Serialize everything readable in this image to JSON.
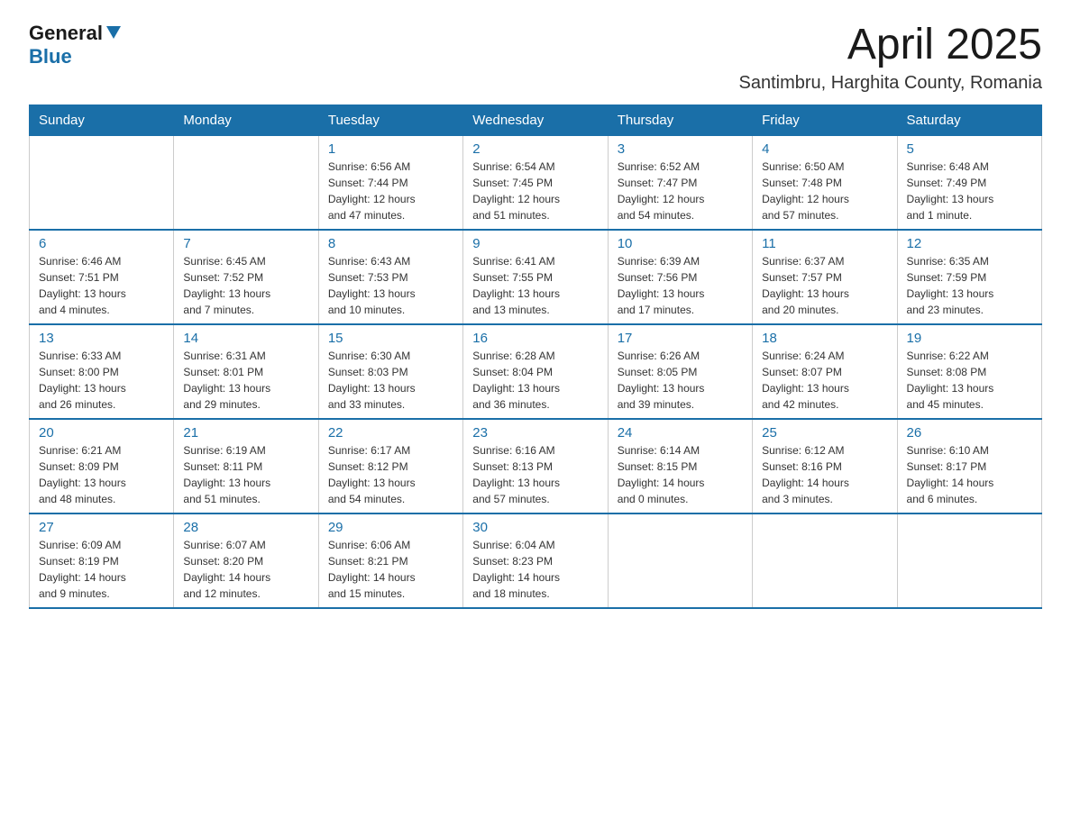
{
  "header": {
    "logo_general": "General",
    "logo_blue": "Blue",
    "month_title": "April 2025",
    "location": "Santimbru, Harghita County, Romania"
  },
  "weekdays": [
    "Sunday",
    "Monday",
    "Tuesday",
    "Wednesday",
    "Thursday",
    "Friday",
    "Saturday"
  ],
  "weeks": [
    [
      {
        "day": "",
        "info": ""
      },
      {
        "day": "",
        "info": ""
      },
      {
        "day": "1",
        "info": "Sunrise: 6:56 AM\nSunset: 7:44 PM\nDaylight: 12 hours\nand 47 minutes."
      },
      {
        "day": "2",
        "info": "Sunrise: 6:54 AM\nSunset: 7:45 PM\nDaylight: 12 hours\nand 51 minutes."
      },
      {
        "day": "3",
        "info": "Sunrise: 6:52 AM\nSunset: 7:47 PM\nDaylight: 12 hours\nand 54 minutes."
      },
      {
        "day": "4",
        "info": "Sunrise: 6:50 AM\nSunset: 7:48 PM\nDaylight: 12 hours\nand 57 minutes."
      },
      {
        "day": "5",
        "info": "Sunrise: 6:48 AM\nSunset: 7:49 PM\nDaylight: 13 hours\nand 1 minute."
      }
    ],
    [
      {
        "day": "6",
        "info": "Sunrise: 6:46 AM\nSunset: 7:51 PM\nDaylight: 13 hours\nand 4 minutes."
      },
      {
        "day": "7",
        "info": "Sunrise: 6:45 AM\nSunset: 7:52 PM\nDaylight: 13 hours\nand 7 minutes."
      },
      {
        "day": "8",
        "info": "Sunrise: 6:43 AM\nSunset: 7:53 PM\nDaylight: 13 hours\nand 10 minutes."
      },
      {
        "day": "9",
        "info": "Sunrise: 6:41 AM\nSunset: 7:55 PM\nDaylight: 13 hours\nand 13 minutes."
      },
      {
        "day": "10",
        "info": "Sunrise: 6:39 AM\nSunset: 7:56 PM\nDaylight: 13 hours\nand 17 minutes."
      },
      {
        "day": "11",
        "info": "Sunrise: 6:37 AM\nSunset: 7:57 PM\nDaylight: 13 hours\nand 20 minutes."
      },
      {
        "day": "12",
        "info": "Sunrise: 6:35 AM\nSunset: 7:59 PM\nDaylight: 13 hours\nand 23 minutes."
      }
    ],
    [
      {
        "day": "13",
        "info": "Sunrise: 6:33 AM\nSunset: 8:00 PM\nDaylight: 13 hours\nand 26 minutes."
      },
      {
        "day": "14",
        "info": "Sunrise: 6:31 AM\nSunset: 8:01 PM\nDaylight: 13 hours\nand 29 minutes."
      },
      {
        "day": "15",
        "info": "Sunrise: 6:30 AM\nSunset: 8:03 PM\nDaylight: 13 hours\nand 33 minutes."
      },
      {
        "day": "16",
        "info": "Sunrise: 6:28 AM\nSunset: 8:04 PM\nDaylight: 13 hours\nand 36 minutes."
      },
      {
        "day": "17",
        "info": "Sunrise: 6:26 AM\nSunset: 8:05 PM\nDaylight: 13 hours\nand 39 minutes."
      },
      {
        "day": "18",
        "info": "Sunrise: 6:24 AM\nSunset: 8:07 PM\nDaylight: 13 hours\nand 42 minutes."
      },
      {
        "day": "19",
        "info": "Sunrise: 6:22 AM\nSunset: 8:08 PM\nDaylight: 13 hours\nand 45 minutes."
      }
    ],
    [
      {
        "day": "20",
        "info": "Sunrise: 6:21 AM\nSunset: 8:09 PM\nDaylight: 13 hours\nand 48 minutes."
      },
      {
        "day": "21",
        "info": "Sunrise: 6:19 AM\nSunset: 8:11 PM\nDaylight: 13 hours\nand 51 minutes."
      },
      {
        "day": "22",
        "info": "Sunrise: 6:17 AM\nSunset: 8:12 PM\nDaylight: 13 hours\nand 54 minutes."
      },
      {
        "day": "23",
        "info": "Sunrise: 6:16 AM\nSunset: 8:13 PM\nDaylight: 13 hours\nand 57 minutes."
      },
      {
        "day": "24",
        "info": "Sunrise: 6:14 AM\nSunset: 8:15 PM\nDaylight: 14 hours\nand 0 minutes."
      },
      {
        "day": "25",
        "info": "Sunrise: 6:12 AM\nSunset: 8:16 PM\nDaylight: 14 hours\nand 3 minutes."
      },
      {
        "day": "26",
        "info": "Sunrise: 6:10 AM\nSunset: 8:17 PM\nDaylight: 14 hours\nand 6 minutes."
      }
    ],
    [
      {
        "day": "27",
        "info": "Sunrise: 6:09 AM\nSunset: 8:19 PM\nDaylight: 14 hours\nand 9 minutes."
      },
      {
        "day": "28",
        "info": "Sunrise: 6:07 AM\nSunset: 8:20 PM\nDaylight: 14 hours\nand 12 minutes."
      },
      {
        "day": "29",
        "info": "Sunrise: 6:06 AM\nSunset: 8:21 PM\nDaylight: 14 hours\nand 15 minutes."
      },
      {
        "day": "30",
        "info": "Sunrise: 6:04 AM\nSunset: 8:23 PM\nDaylight: 14 hours\nand 18 minutes."
      },
      {
        "day": "",
        "info": ""
      },
      {
        "day": "",
        "info": ""
      },
      {
        "day": "",
        "info": ""
      }
    ]
  ]
}
